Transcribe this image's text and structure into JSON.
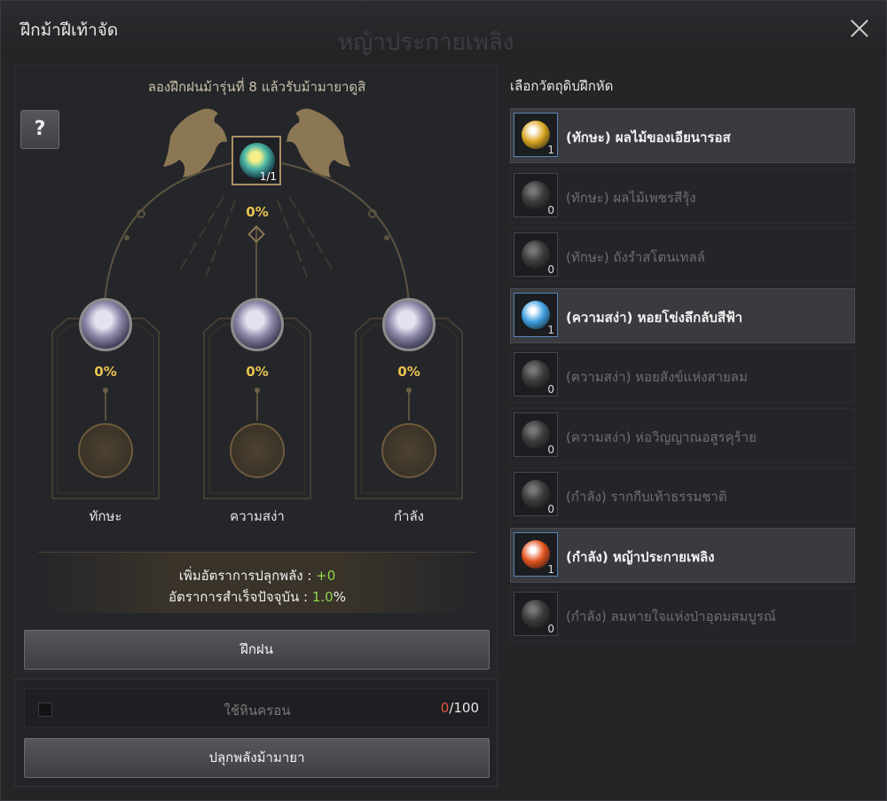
{
  "window": {
    "title": "ฝึกม้าฝีเท้าจัด",
    "ghost_text": "หญ้าประกายเพลิง"
  },
  "left": {
    "subtitle": "ลองฝึกฝนม้ารุ่นที่ 8 แล้วรับม้ามายาดูสิ",
    "help_label": "?",
    "center": {
      "count": "1/1",
      "percent": "0%"
    },
    "categories": [
      {
        "label": "ทักษะ",
        "percent": "0%"
      },
      {
        "label": "ความสง่า",
        "percent": "0%"
      },
      {
        "label": "กำลัง",
        "percent": "0%"
      }
    ],
    "info": {
      "line1_label": "เพิ่มอัตราการปลุกพลัง : ",
      "line1_value": "+0",
      "line2_label": "อัตราการสำเร็จปัจจุบัน : ",
      "line2_value": "1.0",
      "line2_suffix": "%"
    },
    "train_button": "ฝึกฝน"
  },
  "bottom": {
    "checkbox_label": "ใช้หินครอน",
    "count_current": "0",
    "count_total": "/100",
    "awaken_button": "ปลุกพลังม้ามายา"
  },
  "right": {
    "title": "เลือกวัตถุดิบฝึกหัด",
    "items": [
      {
        "name": "(ทักษะ) ผลไม้ของเอียนารอส",
        "qty": "1",
        "active": true,
        "color": "#d9a623"
      },
      {
        "name": "(ทักษะ) ผลไม้เพชรสีรุ้ง",
        "qty": "0",
        "active": false,
        "color": "#3a3a3a"
      },
      {
        "name": "(ทักษะ) ถังรำสโตนเทลล์",
        "qty": "0",
        "active": false,
        "color": "#3a3a3a"
      },
      {
        "name": "(ความสง่า) หอยโข่งลึกลับสีฟ้า",
        "qty": "1",
        "active": true,
        "color": "#3f9fe0"
      },
      {
        "name": "(ความสง่า) หอยสังข์แห่งสายลม",
        "qty": "0",
        "active": false,
        "color": "#3a3a3a"
      },
      {
        "name": "(ความสง่า) ห่อวิญญาณอสูรคุร้าย",
        "qty": "0",
        "active": false,
        "color": "#3a3a3a"
      },
      {
        "name": "(กำลัง) รากกีบเท้าธรรมชาติ",
        "qty": "0",
        "active": false,
        "color": "#3a3a3a"
      },
      {
        "name": "(กำลัง) หญ้าประกายเพลิง",
        "qty": "1",
        "active": true,
        "color": "#e2531f"
      },
      {
        "name": "(กำลัง) ลมหายใจแห่งป่าอุดมสมบูรณ์",
        "qty": "0",
        "active": false,
        "color": "#3a3a3a"
      }
    ]
  }
}
